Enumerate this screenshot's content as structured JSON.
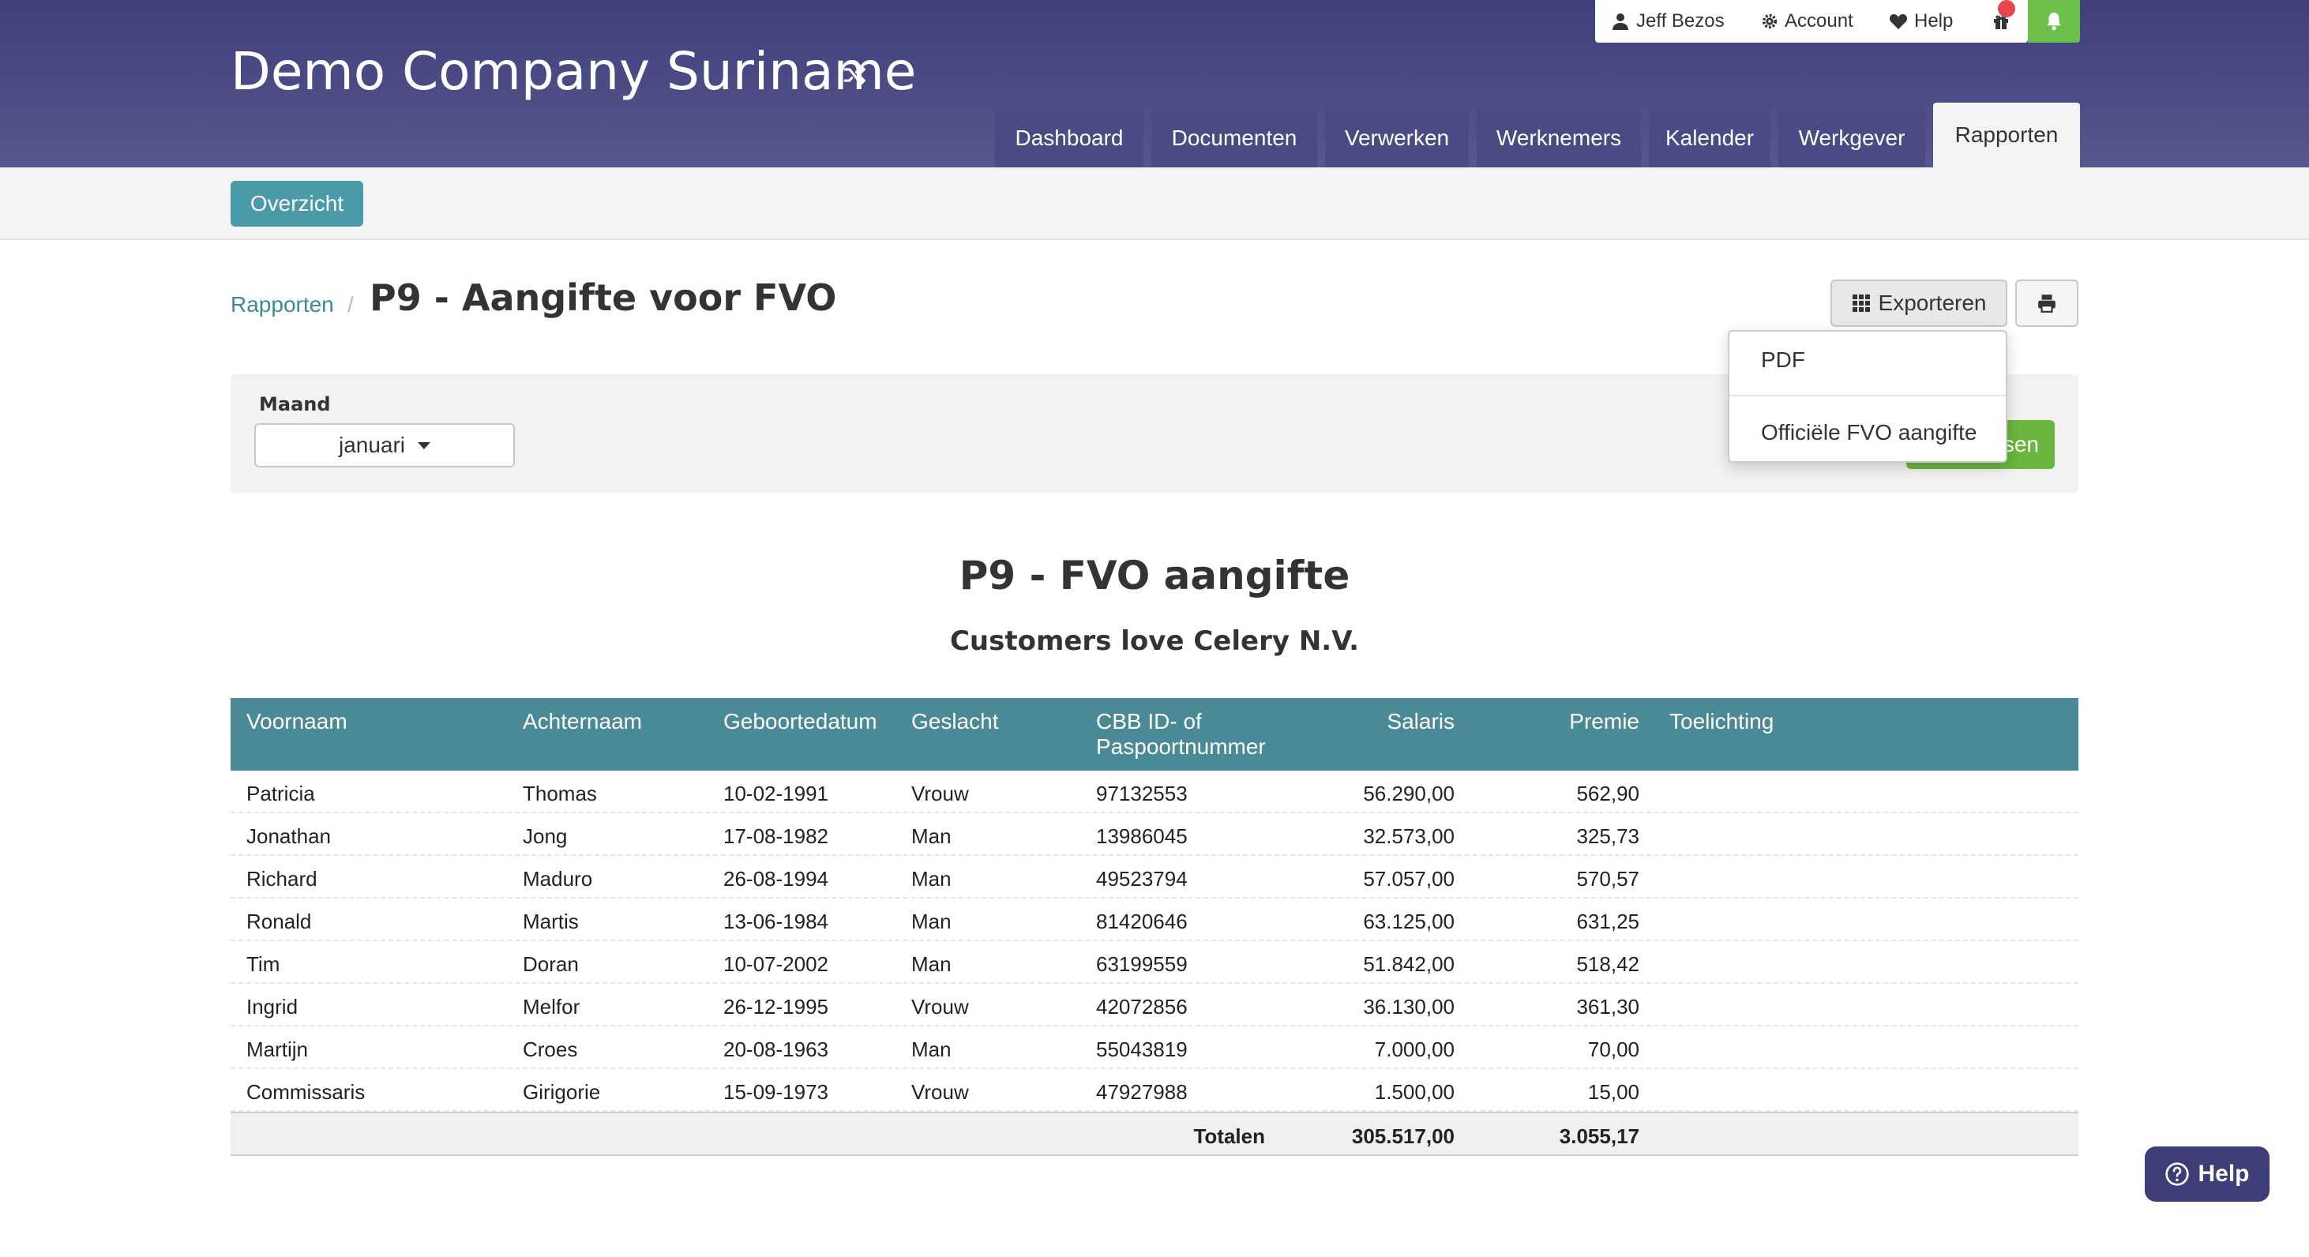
{
  "header": {
    "company": "Demo Company Suriname",
    "user": "Jeff Bezos",
    "account": "Account",
    "help": "Help",
    "tabs": [
      "Dashboard",
      "Documenten",
      "Verwerken",
      "Werknemers",
      "Kalender",
      "Werkgever",
      "Rapporten"
    ],
    "active_tab": "Rapporten",
    "colors": {
      "header": "#4a4a85",
      "accent": "#4a8a96",
      "bell": "#6dbf4b"
    }
  },
  "subnav": {
    "overzicht": "Overzicht"
  },
  "breadcrumb": {
    "parent": "Rapporten",
    "separator": "/",
    "title": "P9 - Aangifte voor FVO"
  },
  "toolbar": {
    "export_label": "Exporteren",
    "print_icon": "print-icon"
  },
  "dropdown": {
    "items": [
      "PDF",
      "Officiële FVO aangifte"
    ]
  },
  "filter": {
    "label": "Maand",
    "month": "januari",
    "button_suffix": "sen"
  },
  "report": {
    "title": "P9 - FVO aangifte",
    "subtitle": "Customers love Celery N.V.",
    "columns": {
      "voornaam": "Voornaam",
      "achternaam": "Achternaam",
      "geboortedatum": "Geboortedatum",
      "geslacht": "Geslacht",
      "cbb_1": "CBB ID- of",
      "cbb_2": "Paspoortnummer",
      "salaris": "Salaris",
      "premie": "Premie",
      "toelichting": "Toelichting"
    },
    "rows": [
      {
        "voornaam": "Patricia",
        "achternaam": "Thomas",
        "geboortedatum": "10-02-1991",
        "geslacht": "Vrouw",
        "id": "97132553",
        "salaris": "56.290,00",
        "premie": "562,90"
      },
      {
        "voornaam": "Jonathan",
        "achternaam": "Jong",
        "geboortedatum": "17-08-1982",
        "geslacht": "Man",
        "id": "13986045",
        "salaris": "32.573,00",
        "premie": "325,73"
      },
      {
        "voornaam": "Richard",
        "achternaam": "Maduro",
        "geboortedatum": "26-08-1994",
        "geslacht": "Man",
        "id": "49523794",
        "salaris": "57.057,00",
        "premie": "570,57"
      },
      {
        "voornaam": "Ronald",
        "achternaam": "Martis",
        "geboortedatum": "13-06-1984",
        "geslacht": "Man",
        "id": "81420646",
        "salaris": "63.125,00",
        "premie": "631,25"
      },
      {
        "voornaam": "Tim",
        "achternaam": "Doran",
        "geboortedatum": "10-07-2002",
        "geslacht": "Man",
        "id": "63199559",
        "salaris": "51.842,00",
        "premie": "518,42"
      },
      {
        "voornaam": "Ingrid",
        "achternaam": "Melfor",
        "geboortedatum": "26-12-1995",
        "geslacht": "Vrouw",
        "id": "42072856",
        "salaris": "36.130,00",
        "premie": "361,30"
      },
      {
        "voornaam": "Martijn",
        "achternaam": "Croes",
        "geboortedatum": "20-08-1963",
        "geslacht": "Man",
        "id": "55043819",
        "salaris": "7.000,00",
        "premie": "70,00"
      },
      {
        "voornaam": "Commissaris",
        "achternaam": "Girigorie",
        "geboortedatum": "15-09-1973",
        "geslacht": "Vrouw",
        "id": "47927988",
        "salaris": "1.500,00",
        "premie": "15,00"
      }
    ],
    "totals": {
      "label": "Totalen",
      "salaris": "305.517,00",
      "premie": "3.055,17"
    }
  },
  "help_button": "Help"
}
